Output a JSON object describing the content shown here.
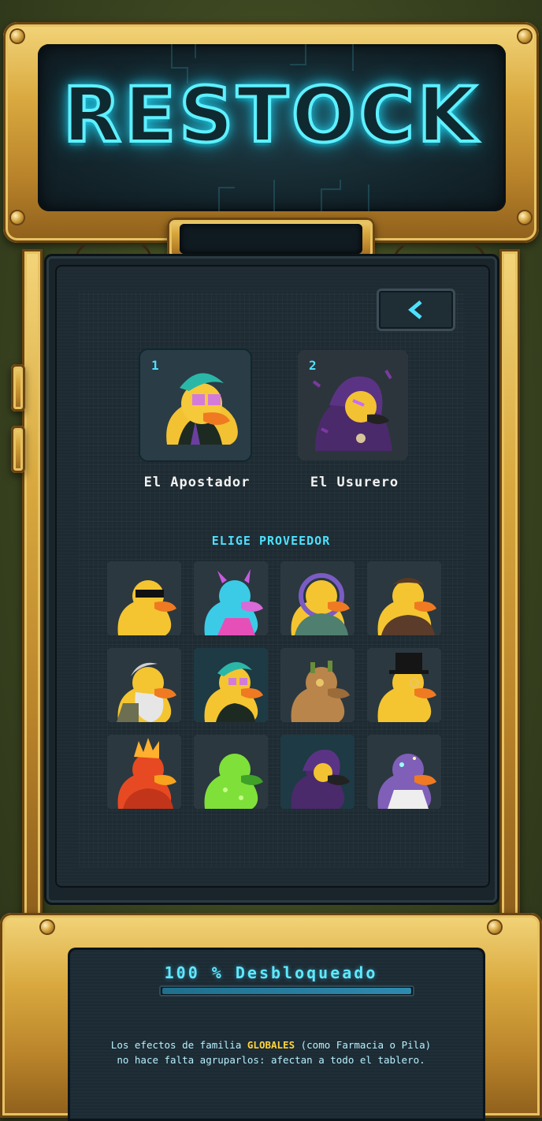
{
  "header": {
    "title": "RESTOCK"
  },
  "back_button": {
    "icon": "chevron-left-icon"
  },
  "featured": [
    {
      "number": "1",
      "name": "El Apostador",
      "avatar": "gambler-duck"
    },
    {
      "number": "2",
      "name": "El Usurero",
      "avatar": "hooded-duck"
    }
  ],
  "section_title": "ELIGE PROVEEDOR",
  "providers": [
    {
      "avatar": "sunglasses-duck"
    },
    {
      "avatar": "horned-neon-duck"
    },
    {
      "avatar": "astronaut-duck"
    },
    {
      "avatar": "aviator-duck"
    },
    {
      "avatar": "bearded-duck"
    },
    {
      "avatar": "gambler-duck"
    },
    {
      "avatar": "steampunk-duck"
    },
    {
      "avatar": "top-hat-duck"
    },
    {
      "avatar": "fire-duck"
    },
    {
      "avatar": "slime-duck"
    },
    {
      "avatar": "hooded-duck"
    },
    {
      "avatar": "galaxy-duck"
    }
  ],
  "footer": {
    "unlock_text": "100 % Desbloqueado",
    "progress": 1.0,
    "tip_before": "Los efectos de familia ",
    "tip_keyword": "GLOBALES",
    "tip_after_1": " (como Farmacia o Pila)",
    "tip_line2": "no hace falta agruparlos: afectan a todo el tablero."
  },
  "colors": {
    "neon": "#5ef0ff",
    "gold": "#d9a93f",
    "keyword": "#ffd33d"
  }
}
